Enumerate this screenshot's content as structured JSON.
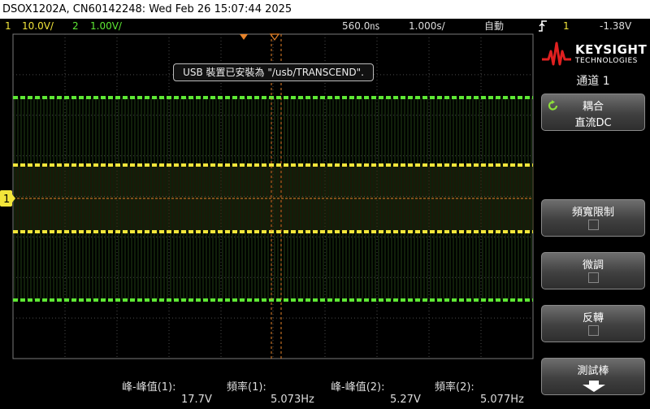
{
  "title_bar": {
    "text": "DSOX1202A, CN60142248: Wed Feb 26 15:07:44 2025"
  },
  "status": {
    "ch1_num": "1",
    "ch1_scale": "10.0V/",
    "ch2_num": "2",
    "ch2_scale": "1.00V/",
    "delay": "560.0㎱",
    "timebase": "1.000s/",
    "trigger_mode": "自動",
    "trigger_icon": "trigger-edge-icon",
    "trigger_source": "1",
    "trigger_level": "-1.38V"
  },
  "toast": {
    "text": "USB 裝置已安裝為 \"/usb/TRANSCEND\"."
  },
  "sidebar": {
    "logo_word": "KEYSIGHT",
    "logo_sub": "TECHNOLOGIES",
    "menu_title": "通道 1",
    "softkeys": [
      {
        "label": "耦合",
        "value": "直流DC"
      },
      {
        "label": "頻寬限制",
        "checked": false
      },
      {
        "label": "微調",
        "checked": false
      },
      {
        "label": "反轉",
        "checked": false
      },
      {
        "label": "測試棒"
      }
    ]
  },
  "measurements": {
    "m1_label": "峰-峰值(1):",
    "m1_value": "17.7V",
    "m2_label": "頻率(1):",
    "m2_value": "5.073Hz",
    "m3_label": "峰-峰值(2):",
    "m3_value": "5.27V",
    "m4_label": "頻率(2):",
    "m4_value": "5.077Hz"
  },
  "colors": {
    "ch1": "#f2e53a",
    "ch2": "#5ee834",
    "trigger": "#e8842a",
    "grid": "#4a4a4a"
  },
  "channel_marker": {
    "label": "1"
  }
}
